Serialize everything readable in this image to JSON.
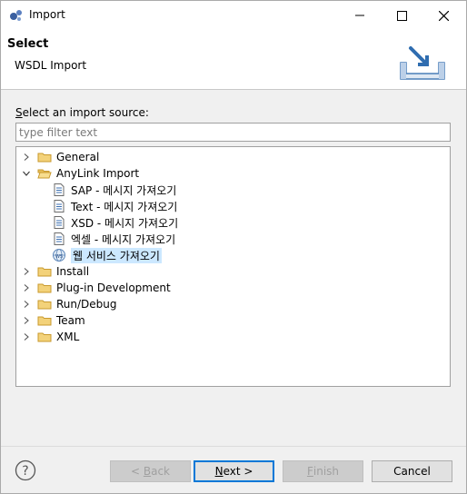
{
  "window": {
    "title": "Import"
  },
  "header": {
    "title": "Select",
    "message": "WSDL Import",
    "banner_icon": "import-wizard-banner-icon"
  },
  "body": {
    "source_label_mnemonic": "S",
    "source_label_rest": "elect an import source:",
    "filter_placeholder": "type filter text",
    "filter_value": ""
  },
  "tree": [
    {
      "label": "General",
      "depth": 0,
      "expanded": false,
      "icon": "folder-icon"
    },
    {
      "label": "AnyLink Import",
      "depth": 0,
      "expanded": true,
      "icon": "folder-open-icon"
    },
    {
      "label": "SAP - 메시지 가져오기",
      "depth": 1,
      "icon": "document-icon"
    },
    {
      "label": "Text - 메시지 가져오기",
      "depth": 1,
      "icon": "document-icon"
    },
    {
      "label": "XSD - 메시지 가져오기",
      "depth": 1,
      "icon": "document-icon"
    },
    {
      "label": "엑셀 - 메시지 가져오기",
      "depth": 1,
      "icon": "document-icon"
    },
    {
      "label": "웹 서비스 가져오기",
      "depth": 1,
      "icon": "web-service-icon",
      "selected": true
    },
    {
      "label": "Install",
      "depth": 0,
      "expanded": false,
      "icon": "folder-icon"
    },
    {
      "label": "Plug-in Development",
      "depth": 0,
      "expanded": false,
      "icon": "folder-icon"
    },
    {
      "label": "Run/Debug",
      "depth": 0,
      "expanded": false,
      "icon": "folder-icon"
    },
    {
      "label": "Team",
      "depth": 0,
      "expanded": false,
      "icon": "folder-icon"
    },
    {
      "label": "XML",
      "depth": 0,
      "expanded": false,
      "icon": "folder-icon"
    }
  ],
  "buttons": {
    "back_prefix": "< ",
    "back_mnemonic": "B",
    "back_rest": "ack",
    "next_mnemonic": "N",
    "next_rest": "ext >",
    "finish_mnemonic": "F",
    "finish_rest": "inish",
    "cancel": "Cancel"
  },
  "colors": {
    "selection": "#cce8ff",
    "default_button_border": "#0078d7",
    "folder": "#e8b54a"
  }
}
